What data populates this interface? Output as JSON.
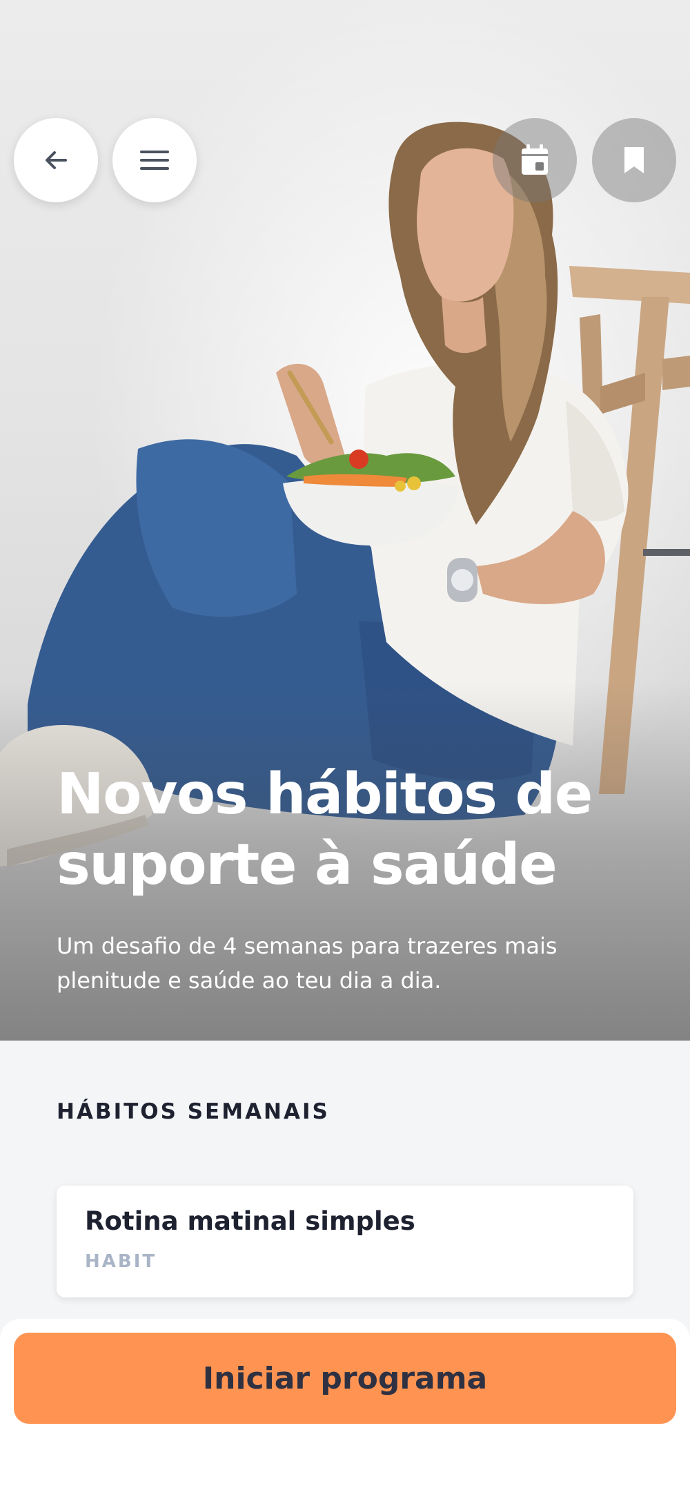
{
  "hero": {
    "title": "Novos hábitos de suporte à saúde",
    "subtitle": "Um desafio de 4 semanas para trazeres mais plenitude e saúde ao teu dia a dia."
  },
  "toolbar": {
    "back_icon": "arrow-left-icon",
    "menu_icon": "hamburger-menu-icon",
    "calendar_icon": "calendar-icon",
    "bookmark_icon": "bookmark-icon"
  },
  "section": {
    "title": "HÁBITOS SEMANAIS"
  },
  "habits": [
    {
      "title": "Rotina matinal simples",
      "type": "HABIT"
    }
  ],
  "cta": {
    "label": "Iniciar programa"
  },
  "colors": {
    "accent": "#ff9452",
    "text_dark": "#1e2230",
    "tag_muted": "#a9b5c7",
    "background": "#f4f5f7"
  }
}
